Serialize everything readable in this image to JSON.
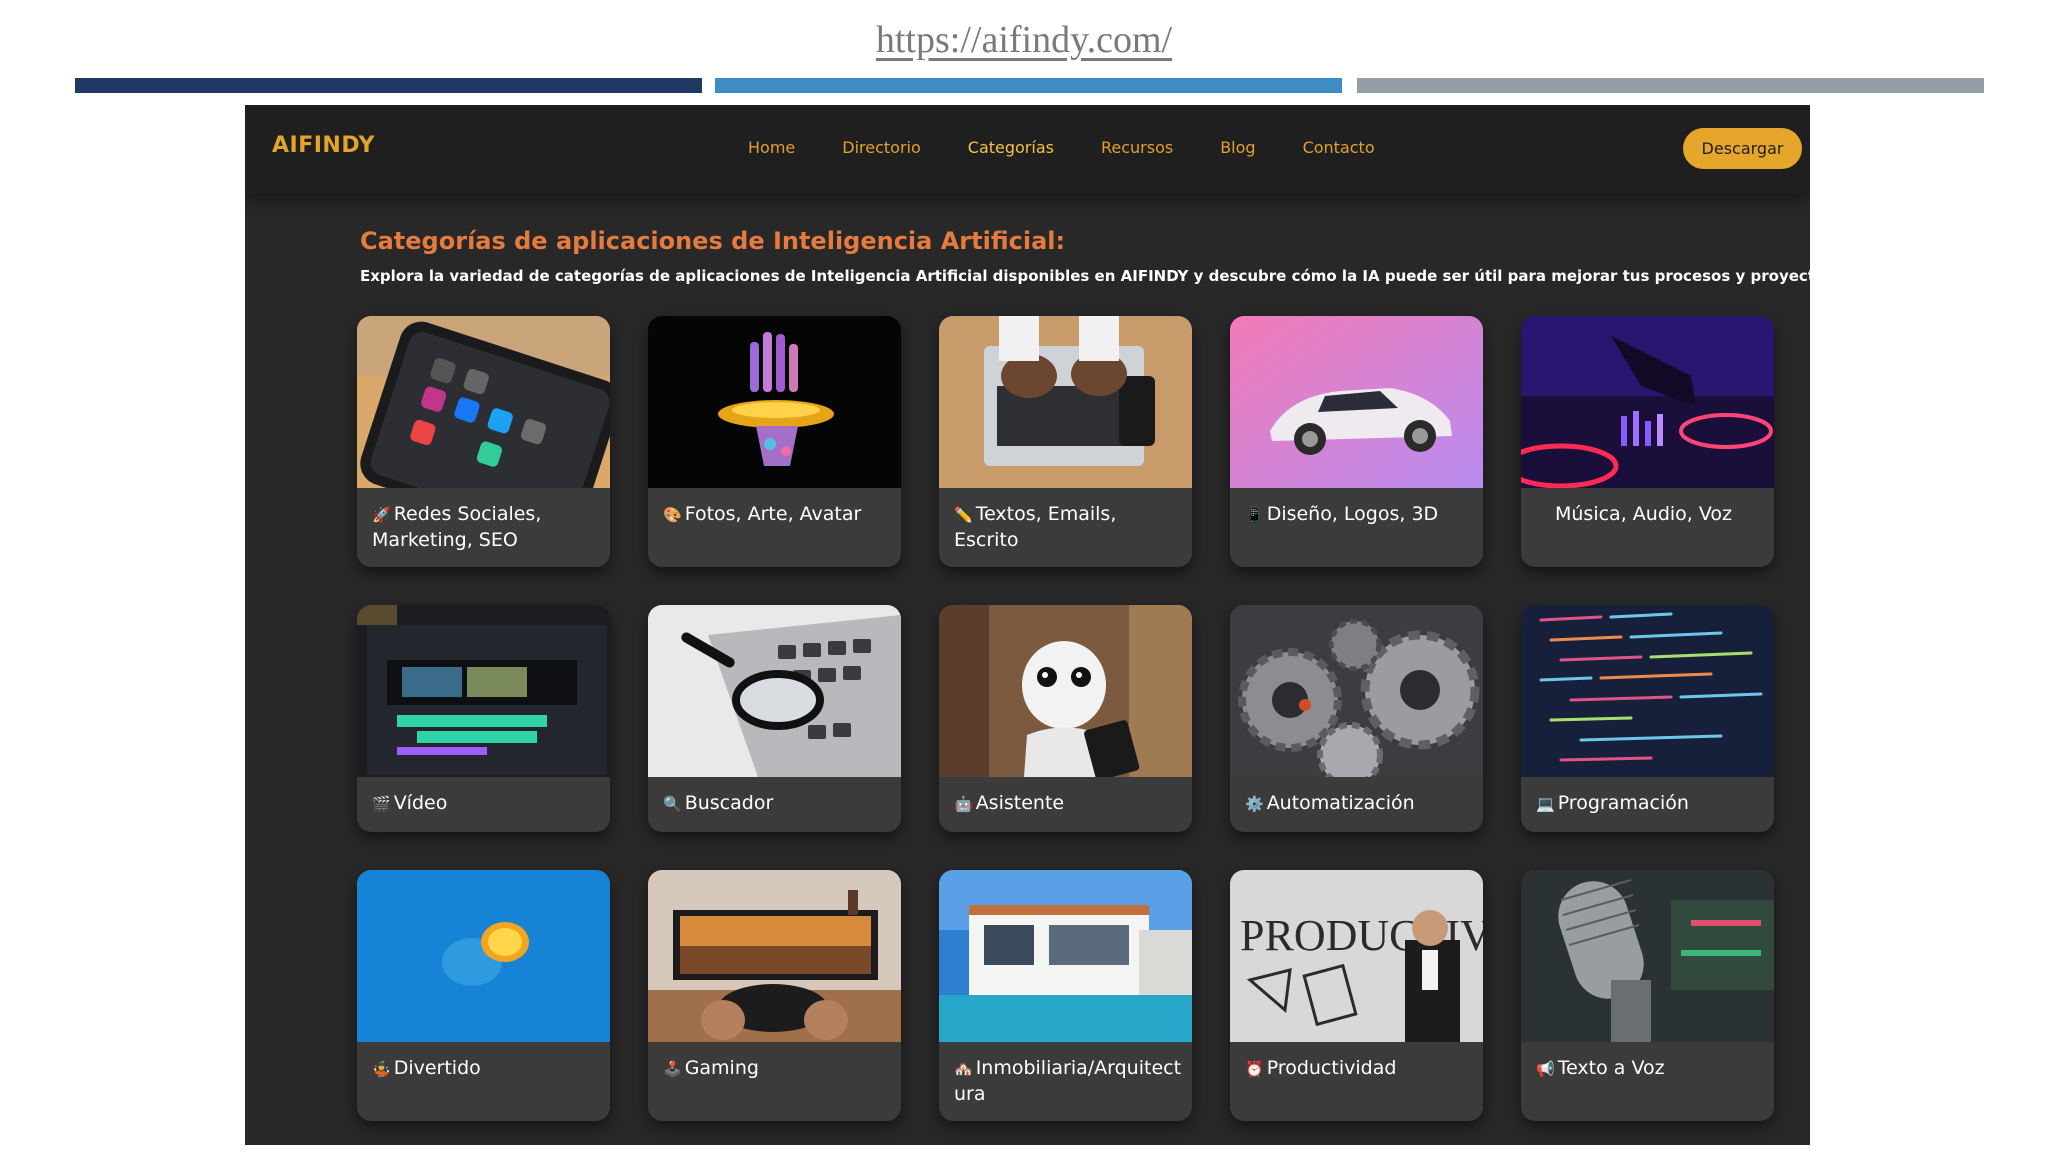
{
  "slide": {
    "url": "https://aifindy.com/",
    "bar_colors": [
      "#1f3864",
      "#3d8cc4",
      "#959ea4"
    ]
  },
  "site": {
    "logo": "AIFINDY",
    "nav": [
      "Home",
      "Directorio",
      "Categorías",
      "Recursos",
      "Blog",
      "Contacto"
    ],
    "active_nav": "Categorías",
    "download_button": "Descargar",
    "accent_color": "#e6a52b",
    "title_color": "#e57b3e"
  },
  "page": {
    "title": "Categorías de aplicaciones de Inteligencia Artificial:",
    "description": "Explora la variedad de categorías de aplicaciones de Inteligencia Artificial disponibles en AIFINDY y descubre cómo la IA puede ser útil para mejorar tus procesos y proyectos."
  },
  "categories": [
    {
      "label": "Redes Sociales, Marketing, SEO",
      "icon": "🚀"
    },
    {
      "label": "Fotos, Arte, Avatar",
      "icon": "🎨"
    },
    {
      "label": "Textos, Emails, Escrito",
      "icon": "✏️"
    },
    {
      "label": "Diseño, Logos, 3D",
      "icon": "📱"
    },
    {
      "label": "Música, Audio, Voz",
      "icon": ""
    },
    {
      "label": "Vídeo",
      "icon": "🎬"
    },
    {
      "label": "Buscador",
      "icon": "🔍"
    },
    {
      "label": "Asistente",
      "icon": "🤖"
    },
    {
      "label": "Automatización",
      "icon": "⚙️"
    },
    {
      "label": "Programación",
      "icon": "💻"
    },
    {
      "label": "Divertido",
      "icon": "🤹"
    },
    {
      "label": "Gaming",
      "icon": "🕹️"
    },
    {
      "label": "Inmobiliaria/Arquitectura",
      "icon": "🏘️"
    },
    {
      "label": "Productividad",
      "icon": "⏰"
    },
    {
      "label": "Texto a Voz",
      "icon": "📢"
    }
  ]
}
